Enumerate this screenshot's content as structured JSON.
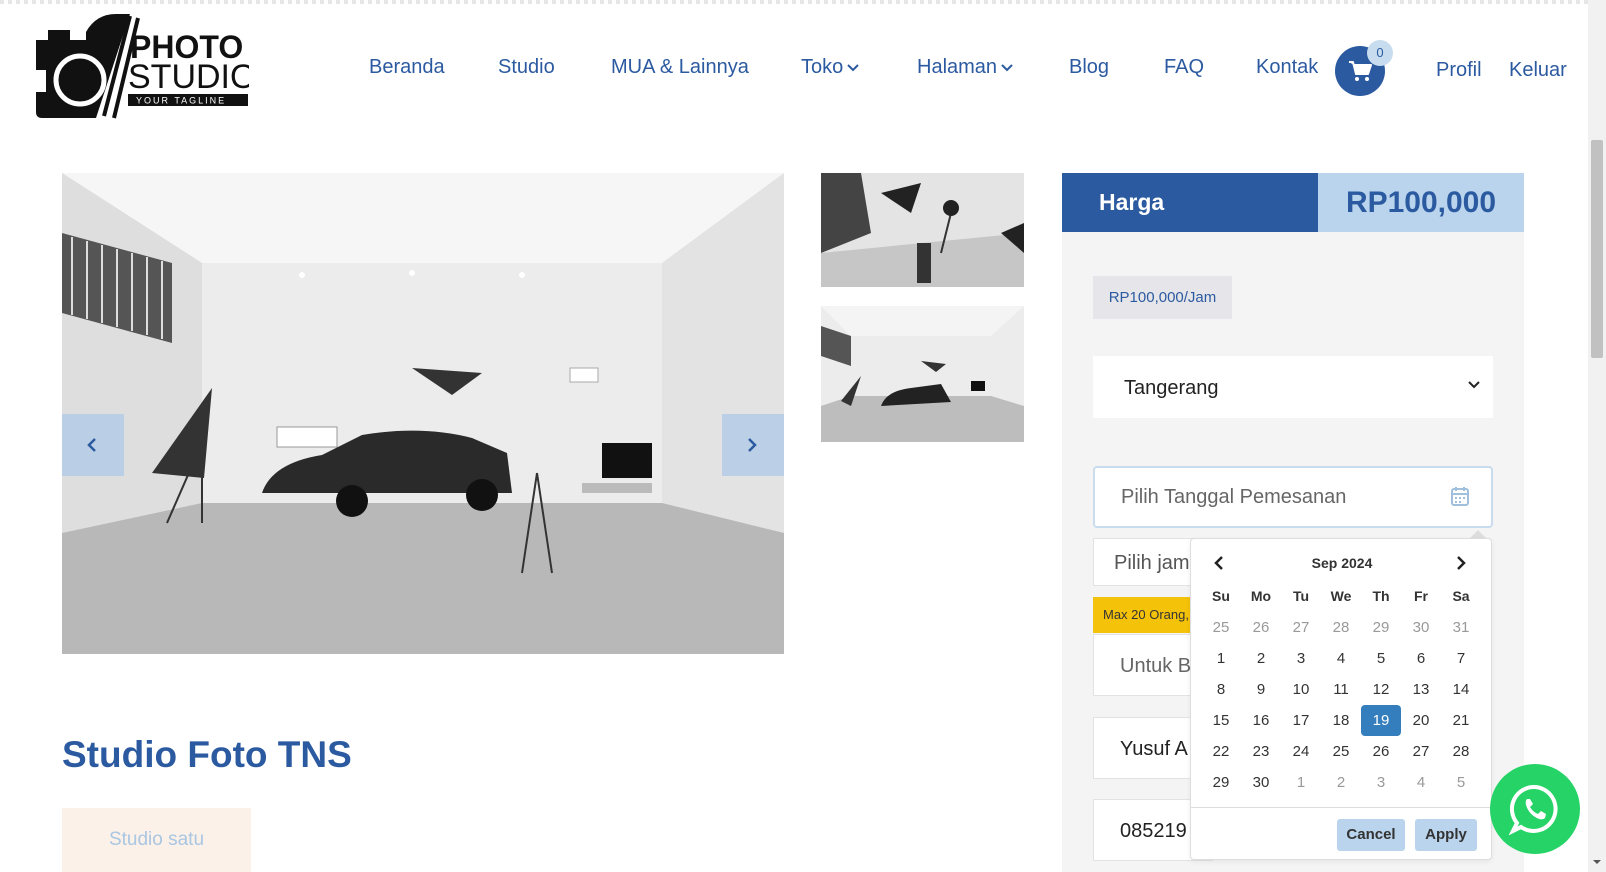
{
  "logo": {
    "line1": "PHOTO",
    "line2": "STUDIO",
    "tagline": "YOUR TAGLINE"
  },
  "nav": {
    "items": [
      {
        "label": "Beranda"
      },
      {
        "label": "Studio"
      },
      {
        "label": "MUA & Lainnya"
      },
      {
        "label": "Toko"
      },
      {
        "label": "Halaman"
      },
      {
        "label": "Blog"
      },
      {
        "label": "FAQ"
      },
      {
        "label": "Kontak"
      }
    ],
    "cart_count": "0",
    "profile": "Profil",
    "logout": "Keluar"
  },
  "product": {
    "title": "Studio Foto TNS",
    "studio_tag": "Studio satu"
  },
  "booking": {
    "price_label": "Harga",
    "price_value": "RP100,000",
    "rate": "RP100,000/Jam",
    "location": "Tangerang",
    "date_placeholder": "Pilih Tanggal Pemesanan",
    "time_placeholder": "Pilih jam",
    "note": "Max 20 Orang,",
    "input1_placeholder": "Untuk B",
    "input2_value": "Yusuf A",
    "input3_value": "085219"
  },
  "datepicker": {
    "month": "Sep 2024",
    "weekdays": [
      "Su",
      "Mo",
      "Tu",
      "We",
      "Th",
      "Fr",
      "Sa"
    ],
    "weeks": [
      [
        "25",
        "26",
        "27",
        "28",
        "29",
        "30",
        "31"
      ],
      [
        "1",
        "2",
        "3",
        "4",
        "5",
        "6",
        "7"
      ],
      [
        "8",
        "9",
        "10",
        "11",
        "12",
        "13",
        "14"
      ],
      [
        "15",
        "16",
        "17",
        "18",
        "19",
        "20",
        "21"
      ],
      [
        "22",
        "23",
        "24",
        "25",
        "26",
        "27",
        "28"
      ],
      [
        "29",
        "30",
        "1",
        "2",
        "3",
        "4",
        "5"
      ]
    ],
    "selected_day": "19",
    "cancel": "Cancel",
    "apply": "Apply"
  },
  "colors": {
    "brand": "#2b5aa0",
    "accent_light": "#b9d4ec",
    "selected_day": "#357ebd",
    "note_bg": "#f5c20a",
    "whatsapp": "#25d366"
  }
}
